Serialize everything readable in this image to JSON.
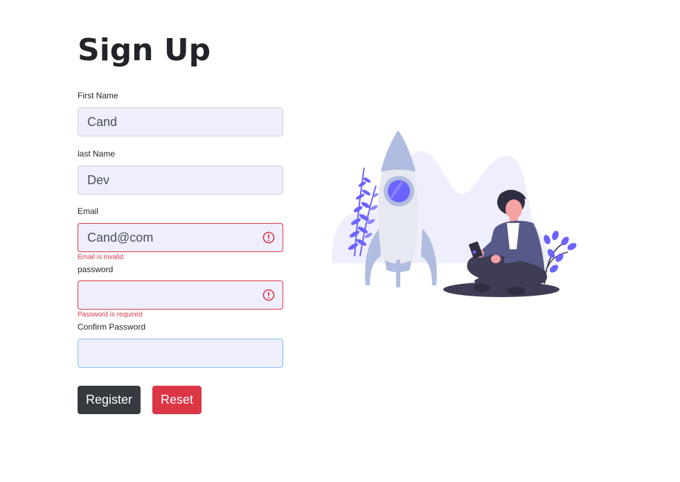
{
  "page": {
    "title": "Sign Up"
  },
  "form": {
    "first_name": {
      "label": "First Name",
      "value": "Cand"
    },
    "last_name": {
      "label": "last Name",
      "value": "Dev"
    },
    "email": {
      "label": "Email",
      "value": "Cand@com",
      "error": "Email is invalid"
    },
    "password": {
      "label": "password",
      "value": "",
      "error": "Password is required"
    },
    "confirm_password": {
      "label": "Confirm Password",
      "value": ""
    },
    "register_label": "Register",
    "reset_label": "Reset"
  },
  "colors": {
    "input_bg": "#eeeefc",
    "error": "#dc3545",
    "register_bg": "#343a40",
    "reset_bg": "#dc3545",
    "accent": "#6c63ff"
  },
  "illustration": {
    "icon": "rocket-launch-illustration"
  }
}
